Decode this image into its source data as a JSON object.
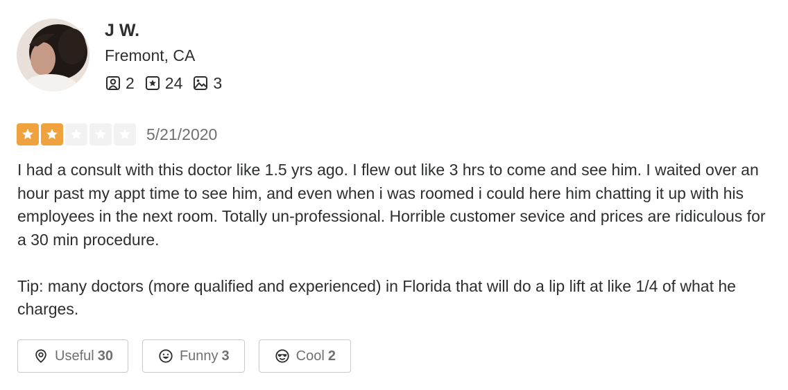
{
  "user": {
    "name": "J W.",
    "location": "Fremont, CA",
    "stats": {
      "friends": "2",
      "reviews": "24",
      "photos": "3"
    }
  },
  "review": {
    "rating": 2,
    "max_rating": 5,
    "date": "5/21/2020",
    "paragraphs": [
      "I had a consult with this doctor like 1.5 yrs ago. I flew out like 3 hrs to come and see him. I waited over an hour past my appt time to see him, and even when i was roomed i could here him chatting it up with his employees in the next room. Totally un-professional. Horrible customer sevice and prices are ridiculous for a 30 min procedure.",
      "Tip: many doctors (more qualified and experienced) in Florida that will do a lip lift at like 1/4 of what he charges."
    ]
  },
  "reactions": {
    "useful": {
      "label": "Useful",
      "count": "30"
    },
    "funny": {
      "label": "Funny",
      "count": "3"
    },
    "cool": {
      "label": "Cool",
      "count": "2"
    }
  },
  "colors": {
    "star_filled": "#f0a23e",
    "star_empty": "#f2f2f2",
    "text": "#2d2e2f",
    "muted": "#6e7072"
  },
  "icons": {
    "friends": "friends-icon",
    "reviews": "review-star-icon",
    "photos": "photo-icon",
    "useful": "lightbulb-icon",
    "funny": "smiley-icon",
    "cool": "sunglasses-icon"
  }
}
